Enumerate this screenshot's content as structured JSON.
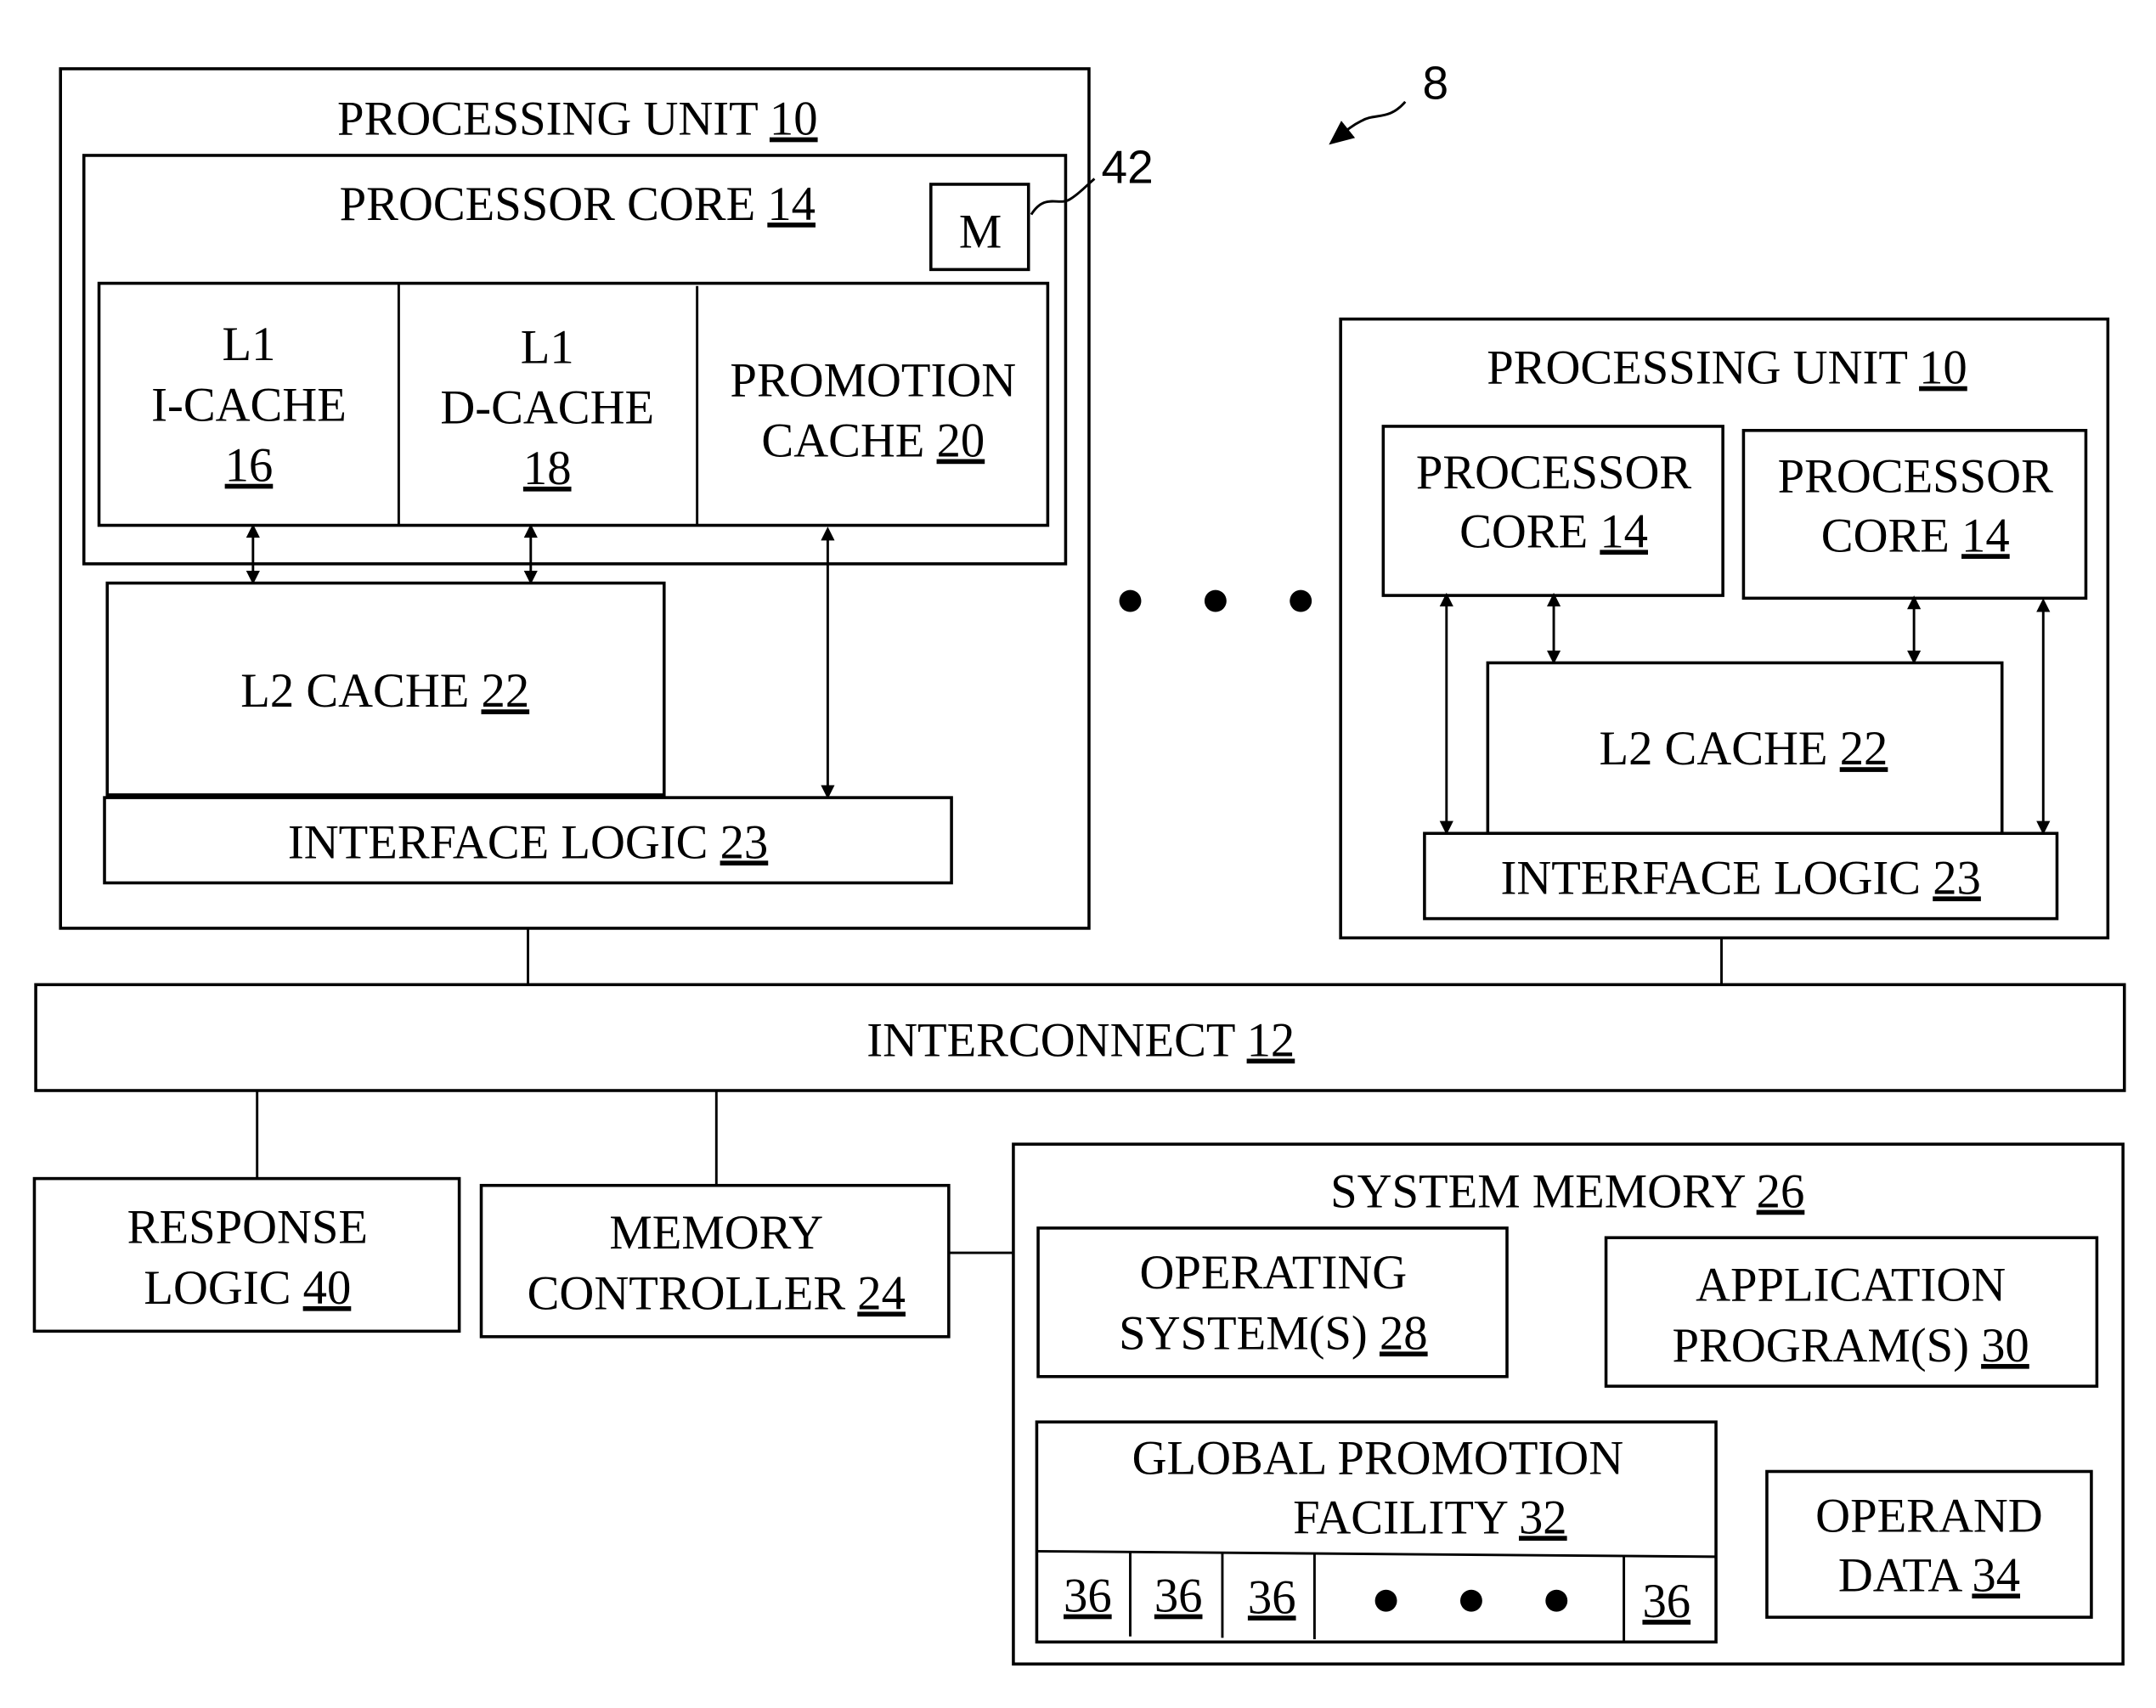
{
  "figure_label": "8",
  "callout_42": "42",
  "pu_left": {
    "title": "PROCESSING UNIT ",
    "ref": "10",
    "core": {
      "title": "PROCESSOR CORE ",
      "ref": "14",
      "m": "M"
    },
    "l1i": {
      "l1": "L1",
      "name": "I-CACHE",
      "ref": "16"
    },
    "l1d": {
      "l1": "L1",
      "name": "D-CACHE",
      "ref": "18"
    },
    "promo": {
      "line1": "PROMOTION",
      "line2": "CACHE ",
      "ref": "20"
    },
    "l2": {
      "name": "L2 CACHE ",
      "ref": "22"
    },
    "iface": {
      "name": "INTERFACE LOGIC ",
      "ref": "23"
    }
  },
  "pu_right": {
    "title": "PROCESSING UNIT ",
    "ref": "10",
    "core1": {
      "line1": "PROCESSOR",
      "line2": "CORE ",
      "ref": "14"
    },
    "core2": {
      "line1": "PROCESSOR",
      "line2": "CORE ",
      "ref": "14"
    },
    "l2": {
      "name": "L2 CACHE ",
      "ref": "22"
    },
    "iface": {
      "name": "INTERFACE LOGIC ",
      "ref": "23"
    }
  },
  "interconnect": {
    "name": "INTERCONNECT ",
    "ref": "12"
  },
  "response": {
    "line1": "RESPONSE",
    "line2": "LOGIC ",
    "ref": "40"
  },
  "memctrl": {
    "line1": "MEMORY",
    "line2": "CONTROLLER ",
    "ref": "24"
  },
  "sysmem": {
    "title": "SYSTEM MEMORY ",
    "ref": "26",
    "os": {
      "line1": "OPERATING",
      "line2": "SYSTEM(S) ",
      "ref": "28"
    },
    "apps": {
      "line1": "APPLICATION",
      "line2": "PROGRAM(S) ",
      "ref": "30"
    },
    "gpf": {
      "line1": "GLOBAL PROMOTION",
      "line2": "FACILITY ",
      "ref": "32",
      "cells": [
        "36",
        "36",
        "36",
        "36"
      ]
    },
    "operand": {
      "line1": "OPERAND",
      "line2": "DATA ",
      "ref": "34"
    }
  }
}
